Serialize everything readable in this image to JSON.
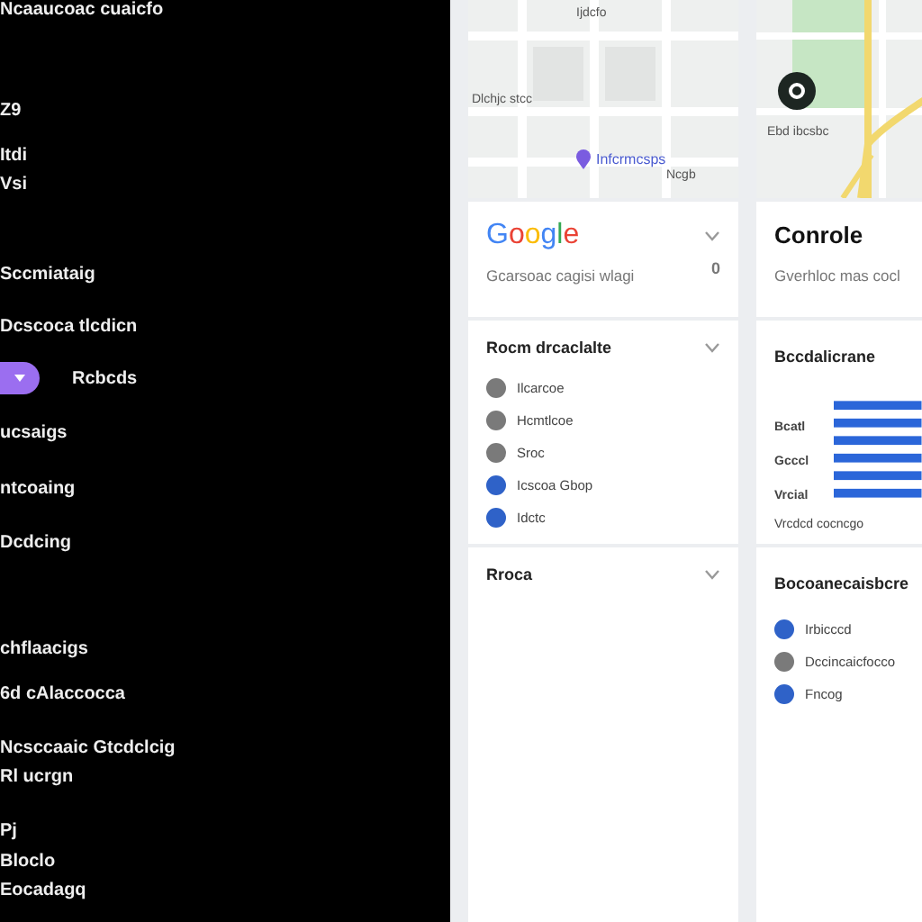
{
  "sidebar": {
    "items": [
      {
        "label": "Ncaaucoac cuaicfo",
        "selected": false
      },
      {
        "label": "Z9",
        "selected": false
      },
      {
        "label": "Itdi",
        "selected": false
      },
      {
        "label": "Vsi",
        "selected": false
      },
      {
        "label": "Sccmiataig",
        "selected": false
      },
      {
        "label": "Dcscoca tlcdicn",
        "selected": false
      },
      {
        "label": "Rcbcds",
        "selected": true
      },
      {
        "label": "ucsaigs",
        "selected": false
      },
      {
        "label": "ntcoaing",
        "selected": false
      },
      {
        "label": "Dcdcing",
        "selected": false
      },
      {
        "label": "chflaacigs",
        "selected": false
      },
      {
        "label": "6d cAlaccocca",
        "selected": false
      },
      {
        "label": "Ncsccaaic Gtcdclcig",
        "selected": false
      },
      {
        "label": "Rl ucrgn",
        "selected": false
      },
      {
        "label": "Pj",
        "selected": false
      },
      {
        "label": "Bloclo",
        "selected": false
      },
      {
        "label": "Eocadagq",
        "selected": false
      }
    ]
  },
  "maps": [
    {
      "labels": [
        "Ijdcfo",
        "Dlchjc stcc",
        "Ncgb"
      ],
      "pin_label": "Infcrmcsps"
    },
    {
      "labels": [
        "Ebd ibcsbc"
      ]
    }
  ],
  "columns": [
    {
      "header": {
        "title": "Google",
        "subtitle": "Gcarsoac cagisi wlagi",
        "count": "0"
      },
      "list_card": {
        "title": "Rocm drcaclalte",
        "items": [
          {
            "label": "Ilcarcoe",
            "color": "#7a7a7a"
          },
          {
            "label": "Hcmtlcoe",
            "color": "#7a7a7a"
          },
          {
            "label": "Sroc",
            "color": "#7a7a7a"
          },
          {
            "label": "Icscoa Gbop",
            "color": "#2f62c8"
          },
          {
            "label": "Idctc",
            "color": "#2f62c8"
          }
        ]
      },
      "empty_card": {
        "title": "Rroca"
      }
    },
    {
      "header": {
        "title": "Conrole",
        "subtitle": "Gverhloc mas cocl"
      },
      "chart_card": {
        "title": "Bccdalicrane",
        "labels": [
          "Bcatl",
          "Gcccl",
          "Vrcial"
        ],
        "footer": "Vrcdcd cocncgo"
      },
      "list_card": {
        "title": "Bocoanecaisbcre",
        "items": [
          {
            "label": "Irbicccd",
            "color": "#2f62c8"
          },
          {
            "label": "Dccincaicfocco",
            "color": "#7a7a7a"
          },
          {
            "label": "Fncog",
            "color": "#2f62c8"
          }
        ]
      }
    }
  ]
}
